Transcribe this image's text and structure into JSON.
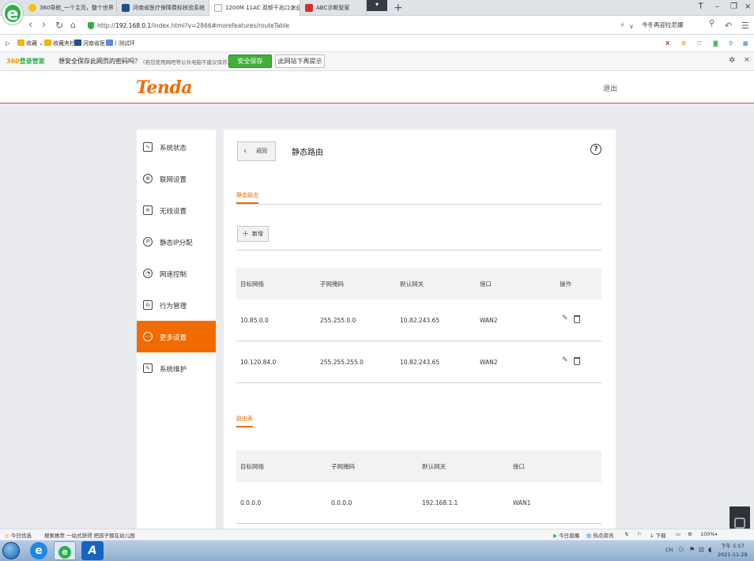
{
  "browser": {
    "tabs": [
      {
        "label": "360导航_一个主页，整个世界",
        "icon_color": "#f5c400"
      },
      {
        "label": "河南省医疗保障费标核验系统",
        "icon_color": "#1f4e8c"
      },
      {
        "label": "1200M 11AC 双频千兆口企业级",
        "icon_color": "#ffffff",
        "active": true
      },
      {
        "label": "ABC诊断管家",
        "icon_color": "#d32f2f"
      }
    ],
    "tab_close": "×",
    "tab_new": "+",
    "tab_dropdown": "▾",
    "window_controls": {
      "pin": "Ꭲ",
      "minimize": "–",
      "restore": "❐",
      "close": "×"
    },
    "url_prefix": "http://",
    "url_host": "192.168.0.1",
    "url_rest": "/index.html?v=2866#morefeatures/routeTable",
    "search_text": "今冬再迎拉尼娜",
    "bookmarks": [
      {
        "label": "收藏",
        "icon_color": "#f4b400"
      },
      {
        "label": "收藏夹栏",
        "icon_color": "#f4b400"
      },
      {
        "label": "河南省医",
        "icon_color": "#1f4e8c"
      },
      {
        "label": "( 测试环",
        "icon_color": "#5b8ed6"
      }
    ],
    "password_bar": {
      "brand_360": "360",
      "brand_rest": "登录管家",
      "question": "想安全保存此网页的密码吗？",
      "note": "（若您使用网吧等公共电脑不建议保存）",
      "save_label": "安全保存",
      "never_label": "此网站下再提示"
    }
  },
  "router": {
    "logo": "Tenda",
    "logout": "退出",
    "sidebar": [
      {
        "label": "系统状态",
        "icon": "chart-icon"
      },
      {
        "label": "联网设置",
        "icon": "globe-icon"
      },
      {
        "label": "无线设置",
        "icon": "wifi-icon"
      },
      {
        "label": "静态IP分配",
        "icon": "ip-icon"
      },
      {
        "label": "网速控制",
        "icon": "gauge-icon"
      },
      {
        "label": "行为管理",
        "icon": "bars-icon"
      },
      {
        "label": "更多设置",
        "icon": "more-icon",
        "active": true
      },
      {
        "label": "系统维护",
        "icon": "wrench-icon"
      }
    ],
    "back_label": "返回",
    "page_title": "静态路由",
    "help": "?",
    "section_static": "静态路由",
    "add_label": "新增",
    "static_headers": [
      "目标网络",
      "子网掩码",
      "默认网关",
      "接口",
      "操作"
    ],
    "static_rows": [
      [
        "10.85.0.0",
        "255.255.0.0",
        "10.82.243.65",
        "WAN2"
      ],
      [
        "10.120.84.0",
        "255.255.255.0",
        "10.82.243.65",
        "WAN2"
      ]
    ],
    "section_route": "路由表",
    "route_headers": [
      "目标网络",
      "子网掩码",
      "默认网关",
      "接口"
    ],
    "route_rows": [
      [
        "0.0.0.0",
        "0.0.0.0",
        "192.168.1.1",
        "WAN1"
      ]
    ]
  },
  "statusbar": {
    "left1": "今日优选",
    "left2": "搜索推荐 一站式获得 把孩子摁在幼儿园",
    "right": [
      "今日直播",
      "热点资讯",
      "下载",
      "100%"
    ]
  },
  "taskbar": {
    "lang": "CH",
    "time": "下午 5:57",
    "date": "2021-11-29"
  }
}
